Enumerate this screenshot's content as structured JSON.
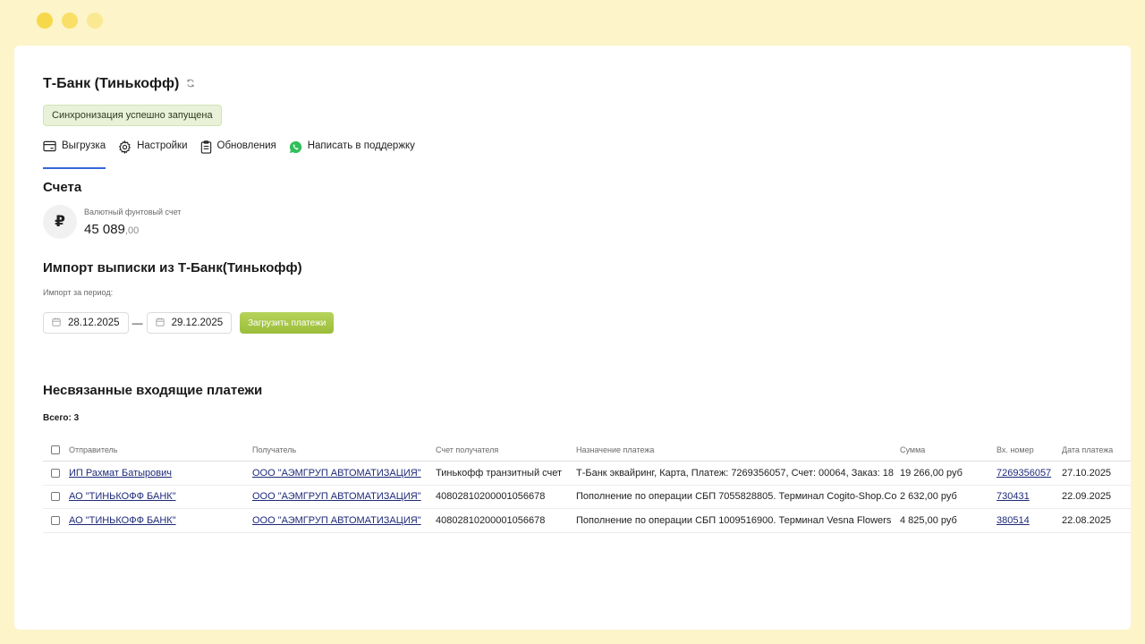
{
  "colors": {
    "accent": "#3566d6",
    "button": "#a5c648",
    "link": "#1e2a78",
    "background": "#fdf5c9"
  },
  "header": {
    "title": "Т-Банк (Тинькофф)",
    "sync_icon": "refresh-icon",
    "sync_status": "Синхронизация успешно запущена"
  },
  "tabs": [
    {
      "label": "Выгрузка",
      "icon": "card-icon",
      "active": true
    },
    {
      "label": "Настройки",
      "icon": "gear-icon",
      "active": false
    },
    {
      "label": "Обновления",
      "icon": "clipboard-icon",
      "active": false
    },
    {
      "label": "Написать в поддержку",
      "icon": "whatsapp-icon",
      "active": false
    }
  ],
  "accounts": {
    "title": "Счета",
    "items": [
      {
        "currency_symbol": "₽",
        "name": "Валютный фунтовый счет",
        "amount_main": "45 089",
        "amount_frac": ",00"
      }
    ]
  },
  "import": {
    "title": "Импорт выписки из Т-Банк(Тинькофф)",
    "period_label": "Импорт за период:",
    "date_from": "28.12.2025",
    "date_separator": "—",
    "date_to": "29.12.2025",
    "load_button": "Загрузить платежи"
  },
  "unlinked": {
    "title": "Несвязанные входящие платежи",
    "total_label": "Всего: 3",
    "columns": [
      "Отправитель",
      "Получатель",
      "Счет получателя",
      "Назначение платежа",
      "Сумма",
      "Вх. номер",
      "Дата платежа"
    ],
    "rows": [
      {
        "sender": "ИП Рахмат Батырович",
        "recipient": "ООО \"АЭМГРУП АВТОМАТИЗАЦИЯ\"",
        "account": "Тинькофф транзитный счет",
        "purpose": "Т-Банк эквайринг, Карта, Платеж: 7269356057, Счет: 00064, Заказ: 18",
        "sum": "19 266,00 руб",
        "number": "7269356057",
        "date": "27.10.2025"
      },
      {
        "sender": "АО \"ТИНЬКОФФ БАНК\"",
        "recipient": "ООО \"АЭМГРУП АВТОМАТИЗАЦИЯ\"",
        "account": "40802810200001056678",
        "purpose": "Пополнение по операции СБП 7055828805. Терминал Cogito-Shop.Co",
        "sum": "2 632,00 руб",
        "number": "730431",
        "date": "22.09.2025"
      },
      {
        "sender": "АО \"ТИНЬКОФФ БАНК\"",
        "recipient": "ООО \"АЭМГРУП АВТОМАТИЗАЦИЯ\"",
        "account": "40802810200001056678",
        "purpose": "Пополнение по операции СБП 1009516900. Терминал Vesna Flowers",
        "sum": "4 825,00 руб",
        "number": "380514",
        "date": "22.08.2025"
      }
    ]
  }
}
